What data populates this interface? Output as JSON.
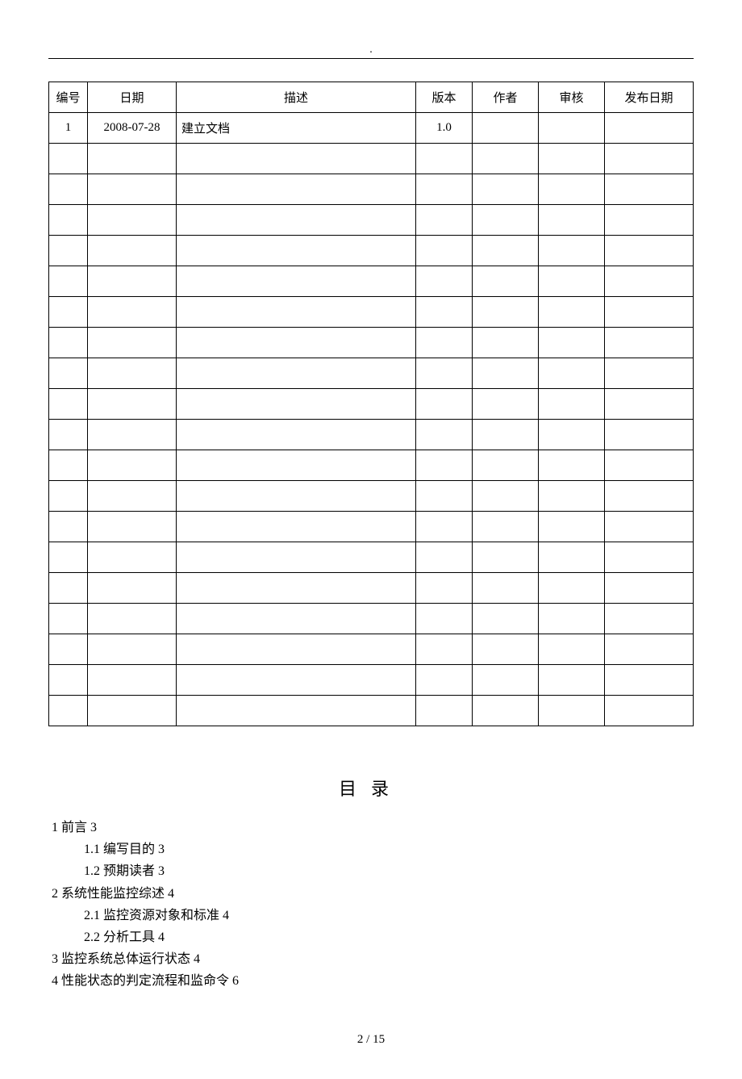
{
  "header_mark": ".",
  "table": {
    "headers": [
      "编号",
      "日期",
      "描述",
      "版本",
      "作者",
      "审核",
      "发布日期"
    ],
    "rows": [
      {
        "no": "1",
        "date": "2008-07-28",
        "desc": "建立文档",
        "ver": "1.0",
        "author": "",
        "reviewer": "",
        "pub": ""
      },
      {
        "no": "",
        "date": "",
        "desc": "",
        "ver": "",
        "author": "",
        "reviewer": "",
        "pub": ""
      },
      {
        "no": "",
        "date": "",
        "desc": "",
        "ver": "",
        "author": "",
        "reviewer": "",
        "pub": ""
      },
      {
        "no": "",
        "date": "",
        "desc": "",
        "ver": "",
        "author": "",
        "reviewer": "",
        "pub": ""
      },
      {
        "no": "",
        "date": "",
        "desc": "",
        "ver": "",
        "author": "",
        "reviewer": "",
        "pub": ""
      },
      {
        "no": "",
        "date": "",
        "desc": "",
        "ver": "",
        "author": "",
        "reviewer": "",
        "pub": ""
      },
      {
        "no": "",
        "date": "",
        "desc": "",
        "ver": "",
        "author": "",
        "reviewer": "",
        "pub": ""
      },
      {
        "no": "",
        "date": "",
        "desc": "",
        "ver": "",
        "author": "",
        "reviewer": "",
        "pub": ""
      },
      {
        "no": "",
        "date": "",
        "desc": "",
        "ver": "",
        "author": "",
        "reviewer": "",
        "pub": ""
      },
      {
        "no": "",
        "date": "",
        "desc": "",
        "ver": "",
        "author": "",
        "reviewer": "",
        "pub": ""
      },
      {
        "no": "",
        "date": "",
        "desc": "",
        "ver": "",
        "author": "",
        "reviewer": "",
        "pub": ""
      },
      {
        "no": "",
        "date": "",
        "desc": "",
        "ver": "",
        "author": "",
        "reviewer": "",
        "pub": ""
      },
      {
        "no": "",
        "date": "",
        "desc": "",
        "ver": "",
        "author": "",
        "reviewer": "",
        "pub": ""
      },
      {
        "no": "",
        "date": "",
        "desc": "",
        "ver": "",
        "author": "",
        "reviewer": "",
        "pub": ""
      },
      {
        "no": "",
        "date": "",
        "desc": "",
        "ver": "",
        "author": "",
        "reviewer": "",
        "pub": ""
      },
      {
        "no": "",
        "date": "",
        "desc": "",
        "ver": "",
        "author": "",
        "reviewer": "",
        "pub": ""
      },
      {
        "no": "",
        "date": "",
        "desc": "",
        "ver": "",
        "author": "",
        "reviewer": "",
        "pub": ""
      },
      {
        "no": "",
        "date": "",
        "desc": "",
        "ver": "",
        "author": "",
        "reviewer": "",
        "pub": ""
      },
      {
        "no": "",
        "date": "",
        "desc": "",
        "ver": "",
        "author": "",
        "reviewer": "",
        "pub": ""
      },
      {
        "no": "",
        "date": "",
        "desc": "",
        "ver": "",
        "author": "",
        "reviewer": "",
        "pub": ""
      }
    ]
  },
  "toc_title": "目录",
  "toc": [
    {
      "level": 1,
      "text": "1 前言 3"
    },
    {
      "level": 2,
      "text": "1.1 编写目的 3"
    },
    {
      "level": 2,
      "text": "1.2 预期读者 3"
    },
    {
      "level": 1,
      "text": "2 系统性能监控综述 4"
    },
    {
      "level": 2,
      "text": "2.1 监控资源对象和标准 4"
    },
    {
      "level": 2,
      "text": "2.2 分析工具 4"
    },
    {
      "level": 1,
      "text": "3 监控系统总体运行状态 4"
    },
    {
      "level": 1,
      "text": "4 性能状态的判定流程和监命令 6"
    }
  ],
  "footer": "2 / 15"
}
